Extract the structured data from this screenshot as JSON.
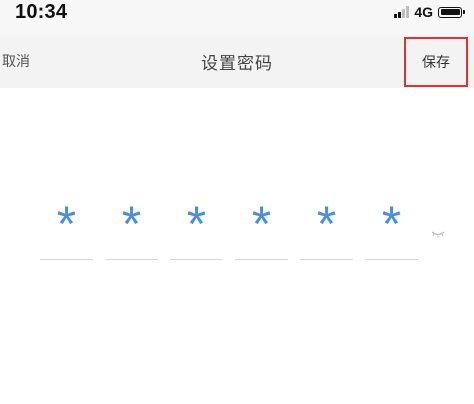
{
  "status_bar": {
    "time": "10:34",
    "network": "4G",
    "icons": [
      "signal-icon",
      "battery-icon"
    ]
  },
  "nav": {
    "cancel_label": "取消",
    "title": "设置密码",
    "save_label": "保存"
  },
  "pin": {
    "digits": [
      "*",
      "*",
      "*",
      "*",
      "*",
      "*"
    ],
    "color": "#4a8ee0",
    "toggle_icon": "eye-closed-icon"
  },
  "colors": {
    "highlight_border": "#e0322e",
    "nav_background": "#f3f3f3"
  }
}
